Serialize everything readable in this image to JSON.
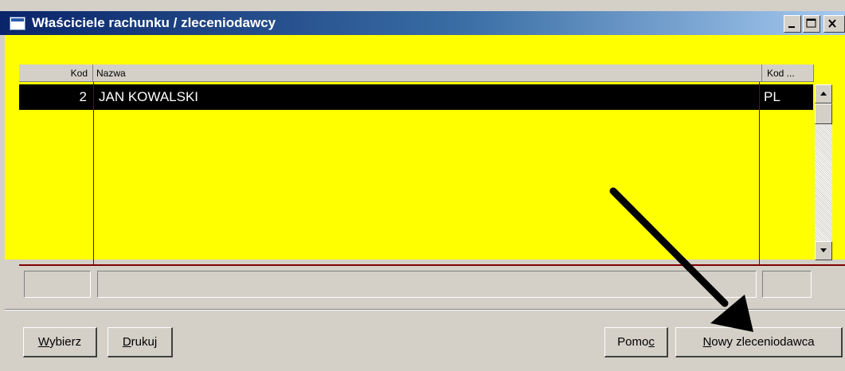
{
  "window": {
    "title": "Właściciele rachunku / zleceniodawcy",
    "controls": [
      "minimize-icon",
      "maximize-icon",
      "close-icon"
    ]
  },
  "colors": {
    "title_bar_start": "#0a246a",
    "title_bar_end": "#a6caf0",
    "panel_background": "#ffff00",
    "selected_row_background": "#000000",
    "selected_row_text": "#ffffff",
    "grid_lines": "#800000",
    "window_face": "#d4d0c8",
    "annotation_arrow": "#000000"
  },
  "grid": {
    "columns": [
      "Kod",
      "Nazwa",
      "Kod ..."
    ],
    "rows": [
      {
        "kod": "2",
        "nazwa": "JAN KOWALSKI",
        "kod_kraju": "PL",
        "selected": true
      }
    ]
  },
  "buttons": {
    "wybierz": {
      "first": "W",
      "rest": "ybierz"
    },
    "drukuj": {
      "first": "D",
      "rest": "rukuj"
    },
    "pomoc": {
      "before": "Pomo",
      "accel": "c"
    },
    "nowy": {
      "first": "N",
      "rest": "owy zleceniodawca"
    }
  },
  "annotation": {
    "icon": "arrow-icon"
  }
}
